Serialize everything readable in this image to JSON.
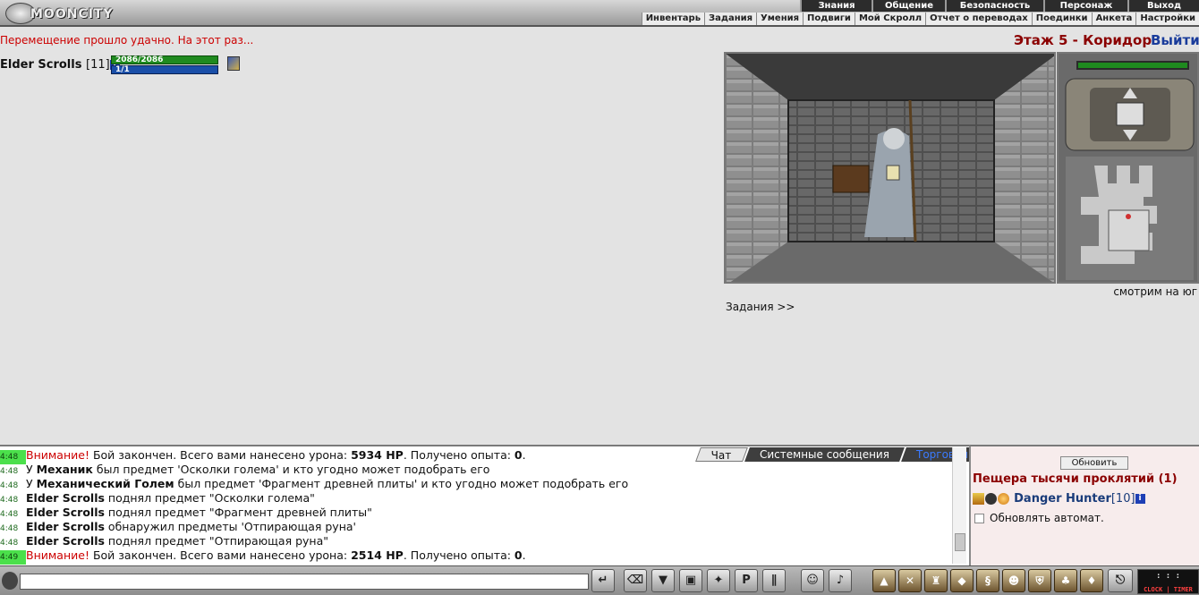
{
  "header": {
    "logo_text": "MOONCITY",
    "top_menu": [
      "Знания",
      "Общение",
      "Безопасность",
      "Персонаж",
      "Выход"
    ],
    "sub_menu": [
      "Инвентарь",
      "Задания",
      "Умения",
      "Подвиги",
      "Мой Скролл",
      "Отчет о переводах",
      "Поединки",
      "Анкета",
      "Настройки"
    ]
  },
  "main": {
    "status_message": "Перемещение прошло удачно. На этот раз...",
    "location": "Этаж 5 - Коридор",
    "exit_label": "Выйти",
    "character": {
      "name": "Elder Scrolls",
      "level": "[11]",
      "hp": "2086/2086",
      "mp": "1/1",
      "hp_fraction": 1.0,
      "mp_fraction": 1.0
    },
    "view_direction": "смотрим на юг",
    "tasks_link": "Задания >>"
  },
  "chat": {
    "tabs": [
      "Чат",
      "Системные сообщения",
      "Торговля"
    ],
    "lines": [
      {
        "time": "4:48",
        "highlight": true,
        "parts": [
          {
            "t": "Внимание!",
            "c": "warn"
          },
          {
            "t": " Бой закончен. Всего вами нанесено урона: "
          },
          {
            "t": "5934 HP",
            "c": "b"
          },
          {
            "t": ". Получено опыта: "
          },
          {
            "t": "0",
            "c": "b"
          },
          {
            "t": "."
          }
        ]
      },
      {
        "time": "4:48",
        "highlight": false,
        "parts": [
          {
            "t": "У "
          },
          {
            "t": "Механик",
            "c": "b"
          },
          {
            "t": " был предмет 'Осколки голема' и кто угодно может подобрать его"
          }
        ]
      },
      {
        "time": "4:48",
        "highlight": false,
        "parts": [
          {
            "t": "У "
          },
          {
            "t": "Механический Голем",
            "c": "b"
          },
          {
            "t": " был предмет 'Фрагмент древней плиты' и кто угодно может подобрать его"
          }
        ]
      },
      {
        "time": "4:48",
        "highlight": false,
        "parts": [
          {
            "t": "Elder Scrolls",
            "c": "b"
          },
          {
            "t": " поднял предмет \"Осколки голема\""
          }
        ]
      },
      {
        "time": "4:48",
        "highlight": false,
        "parts": [
          {
            "t": "Elder Scrolls",
            "c": "b"
          },
          {
            "t": " поднял предмет \"Фрагмент древней плиты\""
          }
        ]
      },
      {
        "time": "4:48",
        "highlight": false,
        "parts": [
          {
            "t": "Elder Scrolls",
            "c": "b"
          },
          {
            "t": " обнаружил предметы 'Отпирающая руна'"
          }
        ]
      },
      {
        "time": "4:48",
        "highlight": false,
        "parts": [
          {
            "t": "Elder Scrolls",
            "c": "b"
          },
          {
            "t": " поднял предмет \"Отпирающая руна\""
          }
        ]
      },
      {
        "time": "4:49",
        "highlight": true,
        "parts": [
          {
            "t": "Внимание!",
            "c": "warn"
          },
          {
            "t": " Бой закончен. Всего вами нанесено урона: "
          },
          {
            "t": "2514 HP",
            "c": "b"
          },
          {
            "t": ". Получено опыта: "
          },
          {
            "t": "0",
            "c": "b"
          },
          {
            "t": "."
          }
        ]
      }
    ]
  },
  "side": {
    "refresh_label": "Обновить",
    "room_title": "Пещера тысячи проклятий (1)",
    "player_name": "Danger Hunter",
    "player_level": "[10]",
    "auto_refresh_label": "Обновлять автомат."
  },
  "toolbar": {
    "input_value": "",
    "clock_label": "CLOCK | TIMER"
  },
  "colors": {
    "location": "#8b0000",
    "exit": "#1a3c9b",
    "status": "#cc0000",
    "hp": "#1f8a1f",
    "mp": "#1a4fa8"
  }
}
